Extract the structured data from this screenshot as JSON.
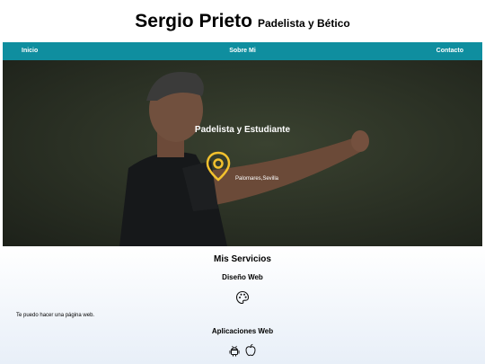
{
  "header": {
    "name": "Sergio Prieto",
    "tagline": "Padelista y Bético"
  },
  "nav": {
    "items": [
      "Inicio",
      "Sobre Mi",
      "Contacto"
    ]
  },
  "hero": {
    "title": "Padelista y Estudiante",
    "location": "Palomares,Sevilla",
    "location_icon": "map-pin-icon",
    "accent_color": "#f2c12e"
  },
  "services": {
    "title": "Mis Servicios",
    "items": [
      {
        "title": "Diseño Web",
        "icon": "palette-icon",
        "description": "Te puedo hacer una página web."
      },
      {
        "title": "Aplicaciones Web",
        "icons": [
          "android-icon",
          "apple-icon"
        ]
      }
    ]
  },
  "colors": {
    "nav": "#0f8e9f"
  }
}
